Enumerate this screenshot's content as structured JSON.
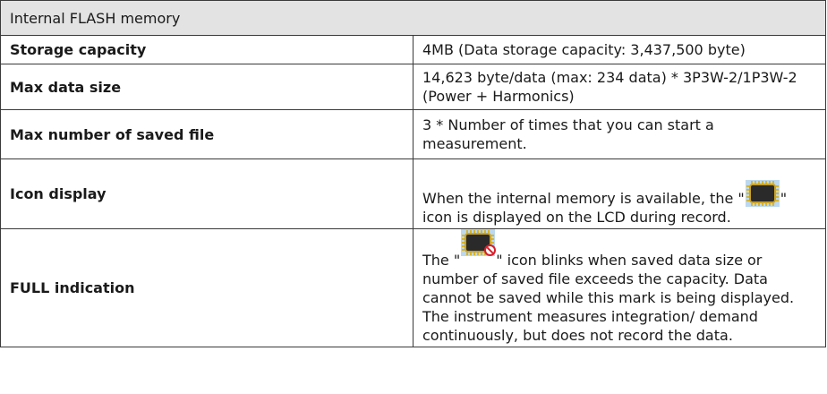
{
  "header": {
    "title": "Internal FLASH memory"
  },
  "rows": [
    {
      "label": "Storage capacity",
      "value": "4MB (Data storage capacity: 3,437,500 byte)"
    },
    {
      "label": "Max data size",
      "value": "14,623 byte/data (max: 234 data) * 3P3W-2/1P3W-2 (Power + Harmonics)"
    },
    {
      "label": "Max number of saved file",
      "value": "3 * Number of times that you can start a measurement."
    },
    {
      "label": "Icon display",
      "value_before_icon": "When the internal memory is available, the \"",
      "value_after_icon": "\" icon is displayed on the LCD during record."
    },
    {
      "label": "FULL indication",
      "value_before_icon": "The \"",
      "value_after_icon": "\" icon blinks when saved data size or number of saved file exceeds the capacity. Data cannot be saved while this mark is being displayed. The instrument measures integration/ demand continuously, but does not record the data."
    }
  ],
  "icons": {
    "memory": "memory-chip-icon",
    "memory_full": "memory-full-icon"
  },
  "colors": {
    "header_background": "#e3e3e3",
    "border": "#3a3a3a",
    "chip_highlight": "#bcd8ee",
    "full_indicator": "#d61f2a"
  }
}
